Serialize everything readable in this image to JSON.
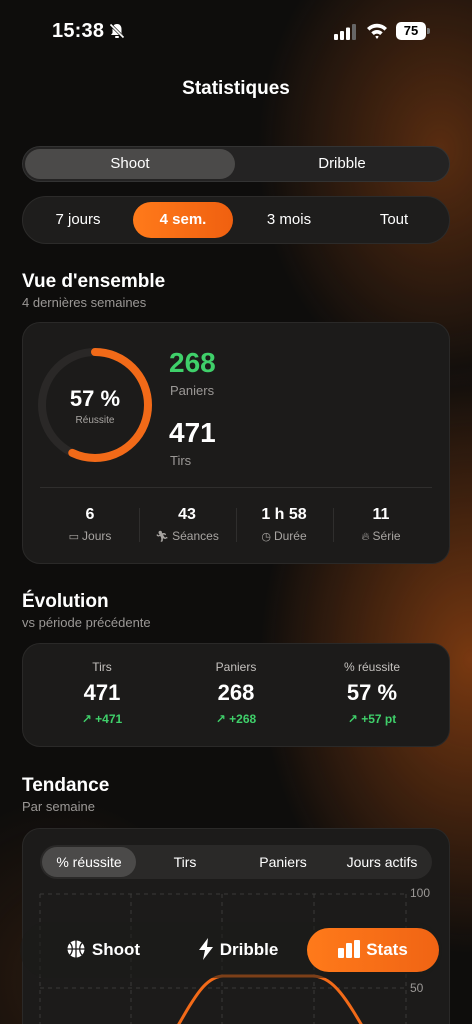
{
  "status": {
    "time": "15:38",
    "battery": "75"
  },
  "page": {
    "title": "Statistiques"
  },
  "mode_tabs": [
    {
      "label": "Shoot",
      "active": true
    },
    {
      "label": "Dribble",
      "active": false
    }
  ],
  "periods": [
    {
      "label": "7 jours",
      "active": false
    },
    {
      "label": "4 sem.",
      "active": true
    },
    {
      "label": "3 mois",
      "active": false
    },
    {
      "label": "Tout",
      "active": false
    }
  ],
  "overview": {
    "title": "Vue d'ensemble",
    "subtitle": "4 dernières semaines",
    "success_rate": 57,
    "success_text": "57 %",
    "success_label": "Réussite",
    "baskets": "268",
    "baskets_label": "Paniers",
    "shots": "471",
    "shots_label": "Tirs",
    "stats": [
      {
        "value": "6",
        "label": "Jours",
        "icon": "calendar-icon"
      },
      {
        "value": "43",
        "label": "Séances",
        "icon": "runner-icon"
      },
      {
        "value": "1 h 58",
        "label": "Durée",
        "icon": "clock-icon"
      },
      {
        "value": "11",
        "label": "Série",
        "icon": "flame-icon"
      }
    ]
  },
  "evolution": {
    "title": "Évolution",
    "subtitle": "vs période précédente",
    "items": [
      {
        "label": "Tirs",
        "value": "471",
        "delta": "+471"
      },
      {
        "label": "Paniers",
        "value": "268",
        "delta": "+268"
      },
      {
        "label": "% réussite",
        "value": "57 %",
        "delta": "+57 pt"
      }
    ]
  },
  "trend": {
    "title": "Tendance",
    "subtitle": "Par semaine",
    "tabs": [
      {
        "label": "% réussite",
        "active": true
      },
      {
        "label": "Tirs",
        "active": false
      },
      {
        "label": "Paniers",
        "active": false
      },
      {
        "label": "Jours actifs",
        "active": false
      }
    ],
    "y_max_label": "100",
    "y_mid_label": "50"
  },
  "nav": [
    {
      "label": "Shoot",
      "icon": "basketball-icon",
      "active": false
    },
    {
      "label": "Dribble",
      "icon": "bolt-icon",
      "active": false
    },
    {
      "label": "Stats",
      "icon": "bar-chart-icon",
      "active": true
    }
  ],
  "colors": {
    "accent": "#f26a18",
    "positive": "#3fd06a"
  }
}
